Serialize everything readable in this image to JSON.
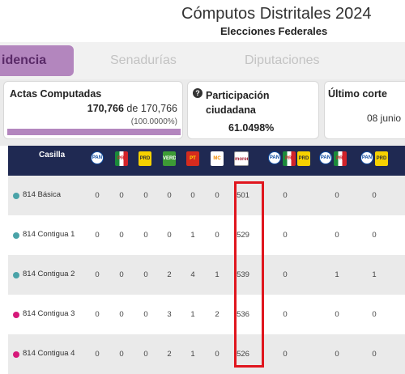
{
  "header": {
    "title": "Cómputos Distritales 2024",
    "subtitle": "Elecciones Federales"
  },
  "tabs": [
    {
      "label": "idencia",
      "active": true
    },
    {
      "label": "Senadurías",
      "active": false
    },
    {
      "label": "Diputaciones",
      "active": false
    }
  ],
  "cards": {
    "actas": {
      "label": "Actas Computadas",
      "computed": "170,766",
      "of_text": "de",
      "total": "170,766",
      "percent": "(100.0000%)",
      "progress": 1.0
    },
    "participacion": {
      "icon_text": "?",
      "label": "Participación ciudadana",
      "value": "61.0498%"
    },
    "corte": {
      "label": "Último corte",
      "value": "08 junio"
    }
  },
  "table": {
    "column_header": "Casilla",
    "party_columns": [
      {
        "logos": [
          {
            "text": "PAN",
            "cls": "pan"
          }
        ]
      },
      {
        "logos": [
          {
            "text": "PRI",
            "cls": "pri"
          }
        ]
      },
      {
        "logos": [
          {
            "text": "PRD",
            "cls": "prd"
          }
        ]
      },
      {
        "logos": [
          {
            "text": "VERDE",
            "cls": "pvem"
          }
        ]
      },
      {
        "logos": [
          {
            "text": "PT",
            "cls": "pt"
          }
        ]
      },
      {
        "logos": [
          {
            "text": "MC",
            "cls": "mc"
          }
        ]
      },
      {
        "logos": [
          {
            "text": "morena",
            "cls": "mor"
          }
        ]
      },
      {
        "logos": [
          {
            "text": "PAN",
            "cls": "pan"
          },
          {
            "text": "PRI",
            "cls": "pri"
          },
          {
            "text": "PRD",
            "cls": "prd"
          }
        ]
      },
      {
        "logos": [
          {
            "text": "PAN",
            "cls": "pan"
          },
          {
            "text": "PRI",
            "cls": "pri"
          }
        ]
      },
      {
        "logos": [
          {
            "text": "PAN",
            "cls": "pan"
          },
          {
            "text": "PRD",
            "cls": "prd"
          }
        ]
      }
    ],
    "rows": [
      {
        "name": "814 Básica",
        "dot_color": "#4aa3a8",
        "values": [
          "0",
          "0",
          "0",
          "0",
          "0",
          "0",
          "501",
          "0",
          "0",
          "0"
        ]
      },
      {
        "name": "814 Contigua 1",
        "dot_color": "#4aa3a8",
        "values": [
          "0",
          "0",
          "0",
          "0",
          "1",
          "0",
          "529",
          "0",
          "0",
          "0"
        ]
      },
      {
        "name": "814 Contigua 2",
        "dot_color": "#4aa3a8",
        "values": [
          "0",
          "0",
          "0",
          "2",
          "4",
          "1",
          "539",
          "0",
          "1",
          "1"
        ]
      },
      {
        "name": "814 Contigua 3",
        "dot_color": "#d6197a",
        "values": [
          "0",
          "0",
          "0",
          "3",
          "1",
          "2",
          "536",
          "0",
          "0",
          "0"
        ]
      },
      {
        "name": "814 Contigua 4",
        "dot_color": "#d6197a",
        "values": [
          "0",
          "0",
          "0",
          "2",
          "1",
          "0",
          "526",
          "0",
          "0",
          "0"
        ]
      }
    ]
  }
}
